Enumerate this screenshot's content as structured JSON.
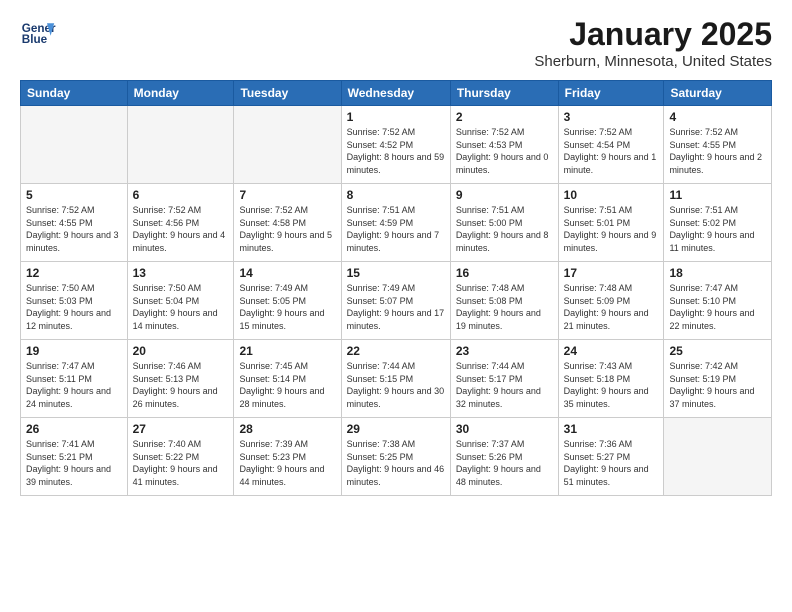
{
  "header": {
    "logo_line1": "General",
    "logo_line2": "Blue",
    "title": "January 2025",
    "location": "Sherburn, Minnesota, United States"
  },
  "weekdays": [
    "Sunday",
    "Monday",
    "Tuesday",
    "Wednesday",
    "Thursday",
    "Friday",
    "Saturday"
  ],
  "weeks": [
    [
      {
        "day": "",
        "info": ""
      },
      {
        "day": "",
        "info": ""
      },
      {
        "day": "",
        "info": ""
      },
      {
        "day": "1",
        "info": "Sunrise: 7:52 AM\nSunset: 4:52 PM\nDaylight: 8 hours\nand 59 minutes."
      },
      {
        "day": "2",
        "info": "Sunrise: 7:52 AM\nSunset: 4:53 PM\nDaylight: 9 hours\nand 0 minutes."
      },
      {
        "day": "3",
        "info": "Sunrise: 7:52 AM\nSunset: 4:54 PM\nDaylight: 9 hours\nand 1 minute."
      },
      {
        "day": "4",
        "info": "Sunrise: 7:52 AM\nSunset: 4:55 PM\nDaylight: 9 hours\nand 2 minutes."
      }
    ],
    [
      {
        "day": "5",
        "info": "Sunrise: 7:52 AM\nSunset: 4:55 PM\nDaylight: 9 hours\nand 3 minutes."
      },
      {
        "day": "6",
        "info": "Sunrise: 7:52 AM\nSunset: 4:56 PM\nDaylight: 9 hours\nand 4 minutes."
      },
      {
        "day": "7",
        "info": "Sunrise: 7:52 AM\nSunset: 4:58 PM\nDaylight: 9 hours\nand 5 minutes."
      },
      {
        "day": "8",
        "info": "Sunrise: 7:51 AM\nSunset: 4:59 PM\nDaylight: 9 hours\nand 7 minutes."
      },
      {
        "day": "9",
        "info": "Sunrise: 7:51 AM\nSunset: 5:00 PM\nDaylight: 9 hours\nand 8 minutes."
      },
      {
        "day": "10",
        "info": "Sunrise: 7:51 AM\nSunset: 5:01 PM\nDaylight: 9 hours\nand 9 minutes."
      },
      {
        "day": "11",
        "info": "Sunrise: 7:51 AM\nSunset: 5:02 PM\nDaylight: 9 hours\nand 11 minutes."
      }
    ],
    [
      {
        "day": "12",
        "info": "Sunrise: 7:50 AM\nSunset: 5:03 PM\nDaylight: 9 hours\nand 12 minutes."
      },
      {
        "day": "13",
        "info": "Sunrise: 7:50 AM\nSunset: 5:04 PM\nDaylight: 9 hours\nand 14 minutes."
      },
      {
        "day": "14",
        "info": "Sunrise: 7:49 AM\nSunset: 5:05 PM\nDaylight: 9 hours\nand 15 minutes."
      },
      {
        "day": "15",
        "info": "Sunrise: 7:49 AM\nSunset: 5:07 PM\nDaylight: 9 hours\nand 17 minutes."
      },
      {
        "day": "16",
        "info": "Sunrise: 7:48 AM\nSunset: 5:08 PM\nDaylight: 9 hours\nand 19 minutes."
      },
      {
        "day": "17",
        "info": "Sunrise: 7:48 AM\nSunset: 5:09 PM\nDaylight: 9 hours\nand 21 minutes."
      },
      {
        "day": "18",
        "info": "Sunrise: 7:47 AM\nSunset: 5:10 PM\nDaylight: 9 hours\nand 22 minutes."
      }
    ],
    [
      {
        "day": "19",
        "info": "Sunrise: 7:47 AM\nSunset: 5:11 PM\nDaylight: 9 hours\nand 24 minutes."
      },
      {
        "day": "20",
        "info": "Sunrise: 7:46 AM\nSunset: 5:13 PM\nDaylight: 9 hours\nand 26 minutes."
      },
      {
        "day": "21",
        "info": "Sunrise: 7:45 AM\nSunset: 5:14 PM\nDaylight: 9 hours\nand 28 minutes."
      },
      {
        "day": "22",
        "info": "Sunrise: 7:44 AM\nSunset: 5:15 PM\nDaylight: 9 hours\nand 30 minutes."
      },
      {
        "day": "23",
        "info": "Sunrise: 7:44 AM\nSunset: 5:17 PM\nDaylight: 9 hours\nand 32 minutes."
      },
      {
        "day": "24",
        "info": "Sunrise: 7:43 AM\nSunset: 5:18 PM\nDaylight: 9 hours\nand 35 minutes."
      },
      {
        "day": "25",
        "info": "Sunrise: 7:42 AM\nSunset: 5:19 PM\nDaylight: 9 hours\nand 37 minutes."
      }
    ],
    [
      {
        "day": "26",
        "info": "Sunrise: 7:41 AM\nSunset: 5:21 PM\nDaylight: 9 hours\nand 39 minutes."
      },
      {
        "day": "27",
        "info": "Sunrise: 7:40 AM\nSunset: 5:22 PM\nDaylight: 9 hours\nand 41 minutes."
      },
      {
        "day": "28",
        "info": "Sunrise: 7:39 AM\nSunset: 5:23 PM\nDaylight: 9 hours\nand 44 minutes."
      },
      {
        "day": "29",
        "info": "Sunrise: 7:38 AM\nSunset: 5:25 PM\nDaylight: 9 hours\nand 46 minutes."
      },
      {
        "day": "30",
        "info": "Sunrise: 7:37 AM\nSunset: 5:26 PM\nDaylight: 9 hours\nand 48 minutes."
      },
      {
        "day": "31",
        "info": "Sunrise: 7:36 AM\nSunset: 5:27 PM\nDaylight: 9 hours\nand 51 minutes."
      },
      {
        "day": "",
        "info": ""
      }
    ]
  ]
}
